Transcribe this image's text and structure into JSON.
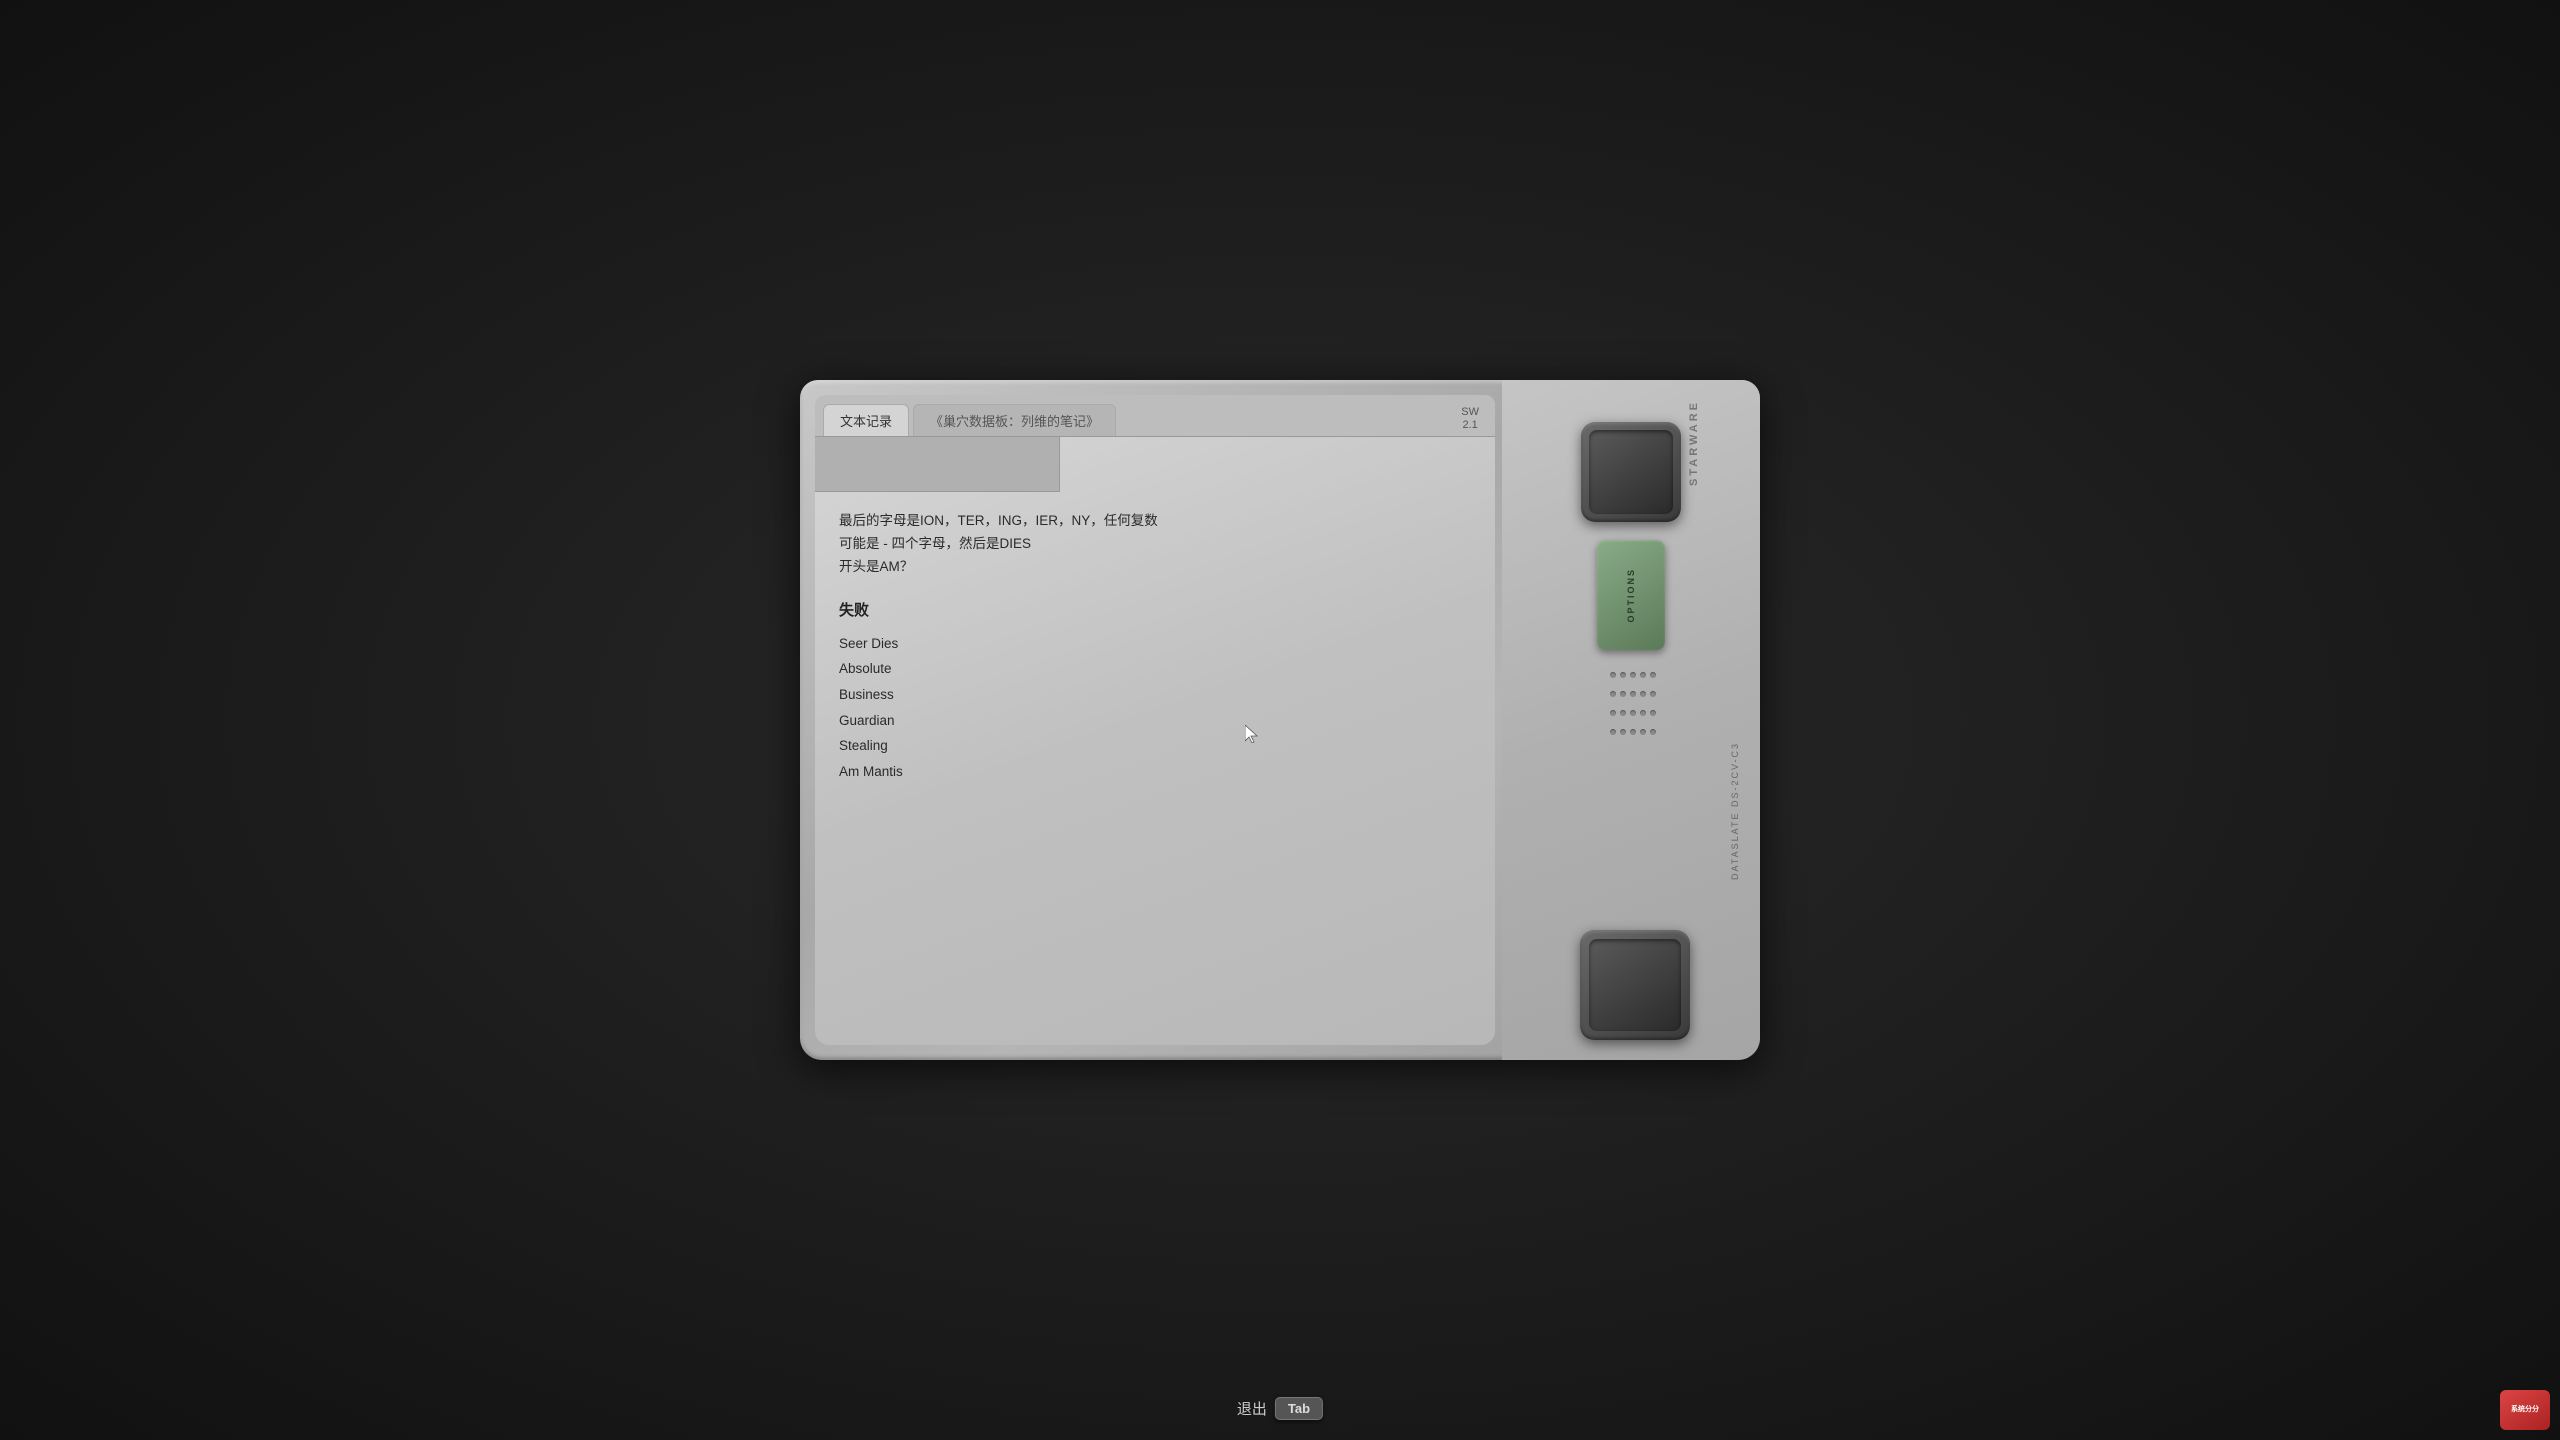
{
  "device": {
    "brand": "STARWARE",
    "model_line1": "DATASLATE",
    "model_line2": "DS-2CV-C3",
    "sw_version_line1": "SW",
    "sw_version_line2": "2.1"
  },
  "tabs": [
    {
      "label": "文本记录",
      "active": true
    },
    {
      "label": "《巢穴数据板：列维的笔记》",
      "active": false
    }
  ],
  "content": {
    "note": "最后的字母是ION，TER，ING，IER，NY，任何复数\n可能是 - 四个字母，然后是DIES\n开头是AM？",
    "section_title": "失败",
    "list_items": [
      "Seer Dies",
      "Absolute",
      "Business",
      "Guardian",
      "Stealing",
      "Am Mantis"
    ]
  },
  "controls": {
    "options_label": "OPTIONS"
  },
  "bottom_bar": {
    "exit_label": "退出",
    "key_label": "Tab"
  },
  "watermark": {
    "line1": "系统分分",
    "line2": ""
  }
}
